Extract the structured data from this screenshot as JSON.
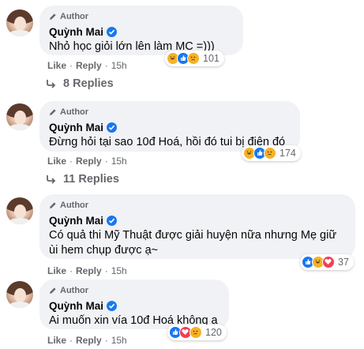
{
  "comments": [
    {
      "badge": "Author",
      "name": "Quỳnh Mai",
      "text": "Nhỏ học giỏi lớn lên làm MC =)))",
      "reactions": [
        "haha",
        "like",
        "sad"
      ],
      "reaction_count": "101",
      "like": "Like",
      "reply": "Reply",
      "time": "15h",
      "replies": "8 Replies"
    },
    {
      "badge": "Author",
      "name": "Quỳnh Mai",
      "text": "Đừng hỏi tại sao 10đ Hoá, hồi đó tui bị điên đó",
      "reactions": [
        "haha",
        "like",
        "sad"
      ],
      "reaction_count": "174",
      "like": "Like",
      "reply": "Reply",
      "time": "15h",
      "replies": "11 Replies"
    },
    {
      "badge": "Author",
      "name": "Quỳnh Mai",
      "text_lines": [
        "Có quả thi Mỹ Thuật được giải huyện nữa nhưng Mẹ giữ",
        "ùi hem chụp được ạ~"
      ],
      "reactions": [
        "like",
        "haha",
        "love"
      ],
      "reaction_count": "37",
      "like": "Like",
      "reply": "Reply",
      "time": "15h"
    },
    {
      "badge": "Author",
      "name": "Quỳnh Mai",
      "text": "Ai muốn xin vía 10đ Hoá không ạ",
      "reactions": [
        "like",
        "love",
        "sad"
      ],
      "reaction_count": "120",
      "like": "Like",
      "reply": "Reply",
      "time": "15h"
    }
  ],
  "colors": {
    "bubble": "#f0f2f5",
    "secondary_text": "#65676b",
    "verified": "#1877f2",
    "like": "#1877f2",
    "haha": "#f7b125",
    "love": "#f33e58"
  }
}
